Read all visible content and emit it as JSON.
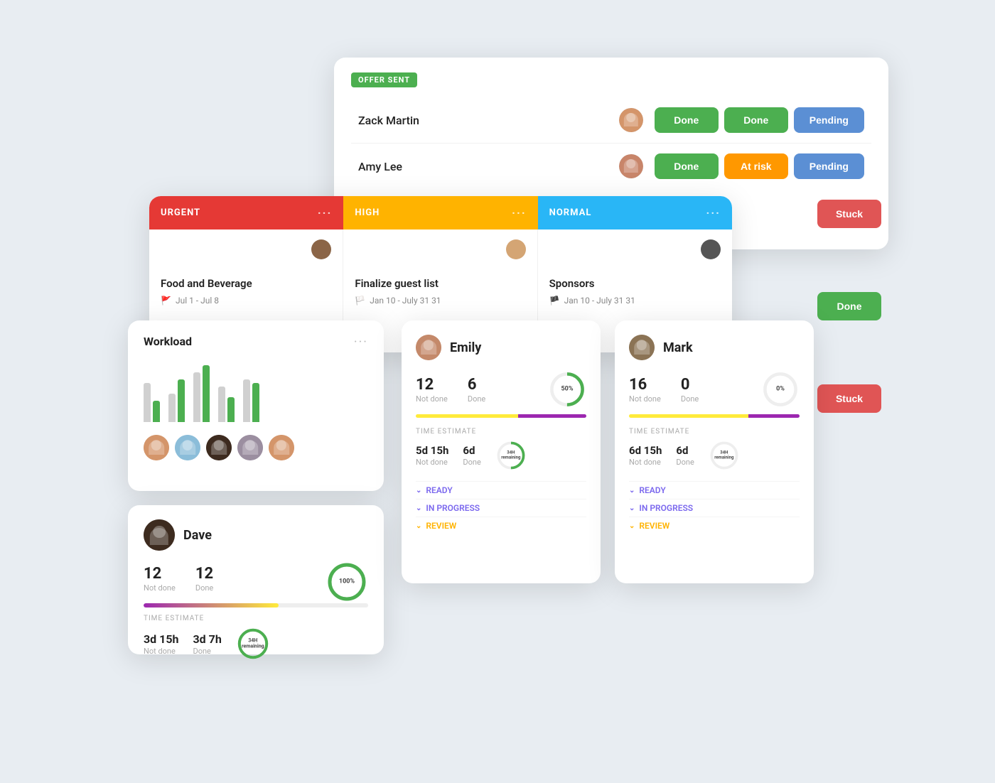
{
  "offer_card": {
    "badge": "OFFER SENT",
    "rows": [
      {
        "name": "Zack Martin",
        "buttons": [
          "Done",
          "Done",
          "Pending"
        ],
        "button_colors": [
          "done",
          "done",
          "pending"
        ]
      },
      {
        "name": "Amy Lee",
        "buttons": [
          "Done",
          "At risk",
          "Pending"
        ],
        "button_colors": [
          "done",
          "at-risk",
          "pending"
        ]
      }
    ]
  },
  "kanban": {
    "columns": [
      {
        "label": "URGENT",
        "color": "urgent",
        "task_title": "Food and Beverage",
        "task_meta": "Jul 1 - Jul 8",
        "flag_color": "red"
      },
      {
        "label": "HIGH",
        "color": "high",
        "task_title": "Finalize guest list",
        "task_meta": "Jan 10 - July 31 31",
        "flag_color": "yellow"
      },
      {
        "label": "NORMAL",
        "color": "normal",
        "task_title": "Sponsors",
        "task_meta": "Jan 10 - July 31 31",
        "flag_color": "blue"
      }
    ]
  },
  "workload": {
    "title": "Workload",
    "dots": "···",
    "bars": [
      {
        "gray": 55,
        "green": 30
      },
      {
        "gray": 40,
        "green": 60
      },
      {
        "gray": 70,
        "green": 80
      },
      {
        "gray": 50,
        "green": 35
      },
      {
        "gray": 60,
        "green": 55
      }
    ]
  },
  "dave": {
    "name": "Dave",
    "not_done": "12",
    "not_done_label": "Not done",
    "done": "12",
    "done_label": "Done",
    "donut_pct": 100,
    "donut_label": "100%",
    "time_estimate_label": "TIME ESTIMATE",
    "time_not_done": "3d 15h",
    "time_done": "3d 7h",
    "remaining_label": "34H\nremaining"
  },
  "emily": {
    "name": "Emily",
    "not_done": "12",
    "not_done_label": "Not done",
    "done": "6",
    "done_label": "Done",
    "donut_pct": 50,
    "donut_label": "50%",
    "time_estimate_label": "TIME ESTIMATE",
    "time_not_done": "5d 15h",
    "time_done": "6d",
    "remaining_label": "34H\nremaining",
    "status_ready": "READY",
    "status_in_progress": "IN PROGRESS",
    "status_review": "REVIEW"
  },
  "mark": {
    "name": "Mark",
    "not_done": "16",
    "not_done_label": "Not done",
    "done": "0",
    "done_label": "Done",
    "donut_pct": 0,
    "donut_label": "0%",
    "time_estimate_label": "TIME ESTIMATE",
    "time_not_done": "6d 15h",
    "time_done": "6d",
    "remaining_label": "34H\nremaining",
    "status_ready": "READY",
    "status_in_progress": "IN PROGRESS",
    "status_review": "REVIEW"
  },
  "right_panel": {
    "stuck_label": "Stuck",
    "done_label": "Done",
    "stuck2_label": "Stuck"
  }
}
